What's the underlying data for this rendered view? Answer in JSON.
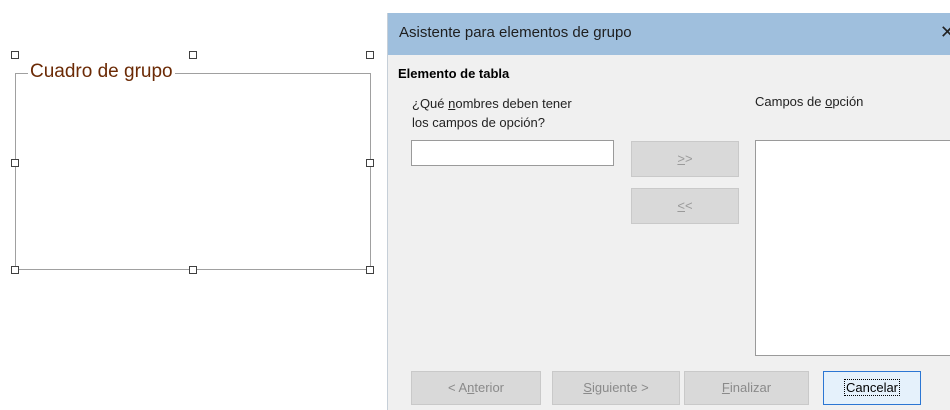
{
  "canvas": {
    "group_box_label": "Cuadro de grupo"
  },
  "dialog": {
    "title": "Asistente para elementos de grupo",
    "close_glyph": "✕",
    "section_header": "Elemento de tabla",
    "question_line1_pre": "¿Qué ",
    "question_line1_mnemonic": "n",
    "question_line1_post": "ombres deben tener",
    "question_line2": "los campos de opción?",
    "name_input_value": "",
    "add_button_mnemonic": ">",
    "add_button_rest": ">",
    "remove_button_mnemonic": "<",
    "remove_button_rest": "<",
    "fields_label_pre": "Campos de ",
    "fields_label_mnemonic": "o",
    "fields_label_post": "pción",
    "footer": {
      "prev_pre": "< A",
      "prev_mnemonic": "n",
      "prev_post": "terior",
      "next_mnemonic": "S",
      "next_post": "iguiente >",
      "finish_mnemonic": "F",
      "finish_post": "inalizar",
      "cancel_label": "Cancelar"
    }
  }
}
